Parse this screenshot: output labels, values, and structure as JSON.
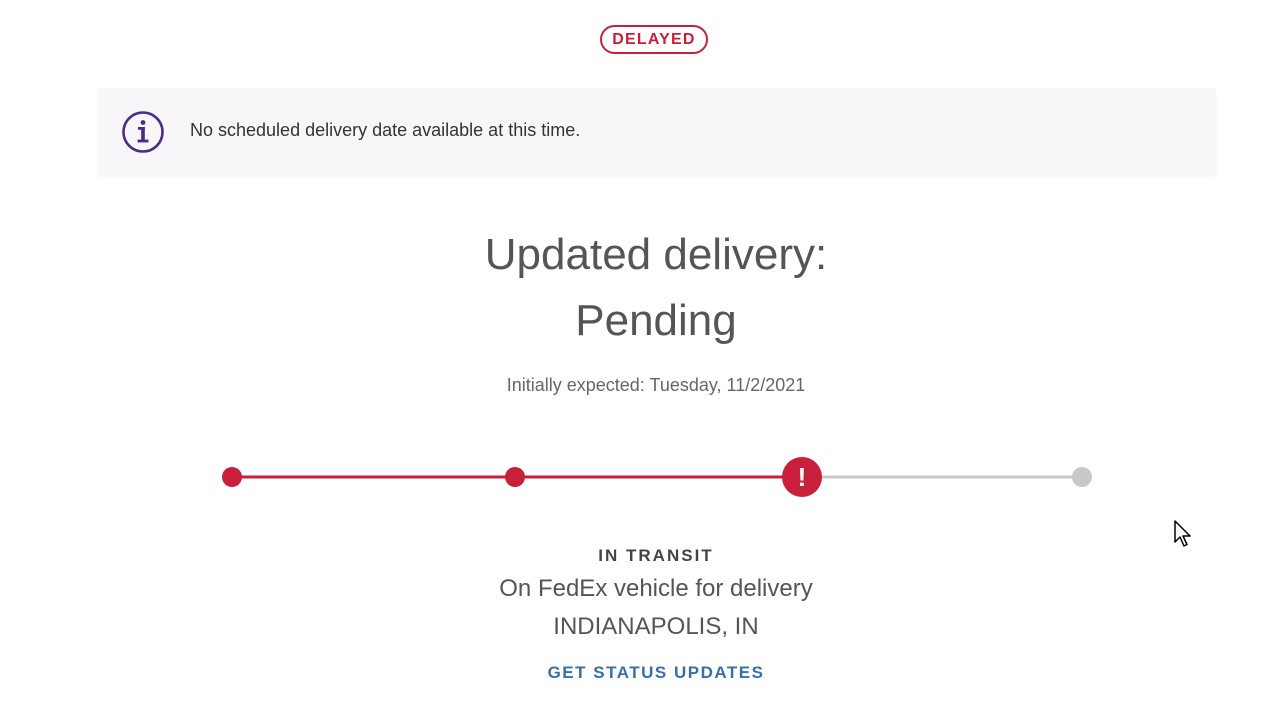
{
  "status_badge": "DELAYED",
  "info_banner": {
    "icon": "info-icon",
    "message": "No scheduled delivery date available at this time."
  },
  "delivery": {
    "heading_line1": "Updated delivery:",
    "heading_line2": "Pending",
    "initially_expected": "Initially expected: Tuesday, 11/2/2021"
  },
  "progress": {
    "steps_total": 4,
    "current_step": 3,
    "current_step_state": "exception",
    "exception_glyph": "!"
  },
  "transit": {
    "status": "IN TRANSIT",
    "description": "On FedEx vehicle for delivery",
    "location": "INDIANAPOLIS, IN"
  },
  "link": {
    "label": "GET STATUS UPDATES"
  },
  "colors": {
    "accent": "#c8203b",
    "inactive": "#c8c8c8",
    "link": "#3a6ea8",
    "info_icon": "#4b2a8a"
  }
}
